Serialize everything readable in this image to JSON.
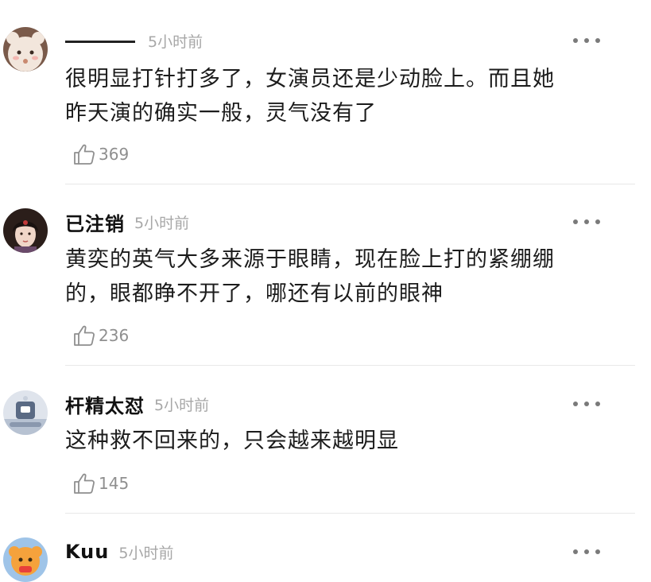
{
  "comments": [
    {
      "username": "",
      "time": "5小时前",
      "text_lines": [
        "很明显打针打多了，女演员还是少动脸上。而且她",
        "昨天演的确实一般，灵气没有了"
      ],
      "likes": "369"
    },
    {
      "username": "已注销",
      "time": "5小时前",
      "text_lines": [
        "黄奕的英气大多来源于眼睛，现在脸上打的紧绷绷",
        "的，眼都睁不开了，哪还有以前的眼神"
      ],
      "likes": "236"
    },
    {
      "username": "杆精太怼",
      "time": "5小时前",
      "text_lines": [
        "这种救不回来的，只会越来越明显"
      ],
      "likes": "145"
    },
    {
      "username": "Kuu",
      "time": "5小时前"
    }
  ],
  "colors": {
    "text": "#1c1c1c",
    "meta": "#a7a7a7",
    "divider": "#e8e8e8",
    "icon": "#8f8f8f"
  },
  "icons": [
    "more-dots-icon",
    "thumbs-up-icon"
  ]
}
